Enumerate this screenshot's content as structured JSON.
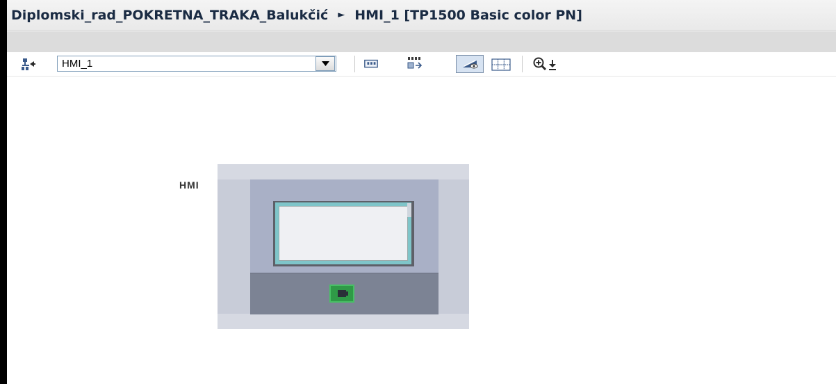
{
  "window": {
    "project_name": "Diplomski_rad_POKRETNA_TRAKA_Balukčić",
    "separator": "►",
    "device_title": "HMI_1 [TP1500 Basic color PN]"
  },
  "toolbar": {
    "device_select_value": "HMI_1",
    "icons": [
      "network-view-icon",
      "dropdown-arrow-icon",
      "interface-icon",
      "name-toggle-icon",
      "display-view-icon",
      "grid-icon",
      "zoom-in-icon",
      "zoom-dropdown-icon"
    ]
  },
  "canvas": {
    "device_label": "HMI"
  },
  "colors": {
    "title_text": "#1a2b43",
    "port_green": "#2f9a47",
    "screen_frame": "#7fc5c9"
  }
}
